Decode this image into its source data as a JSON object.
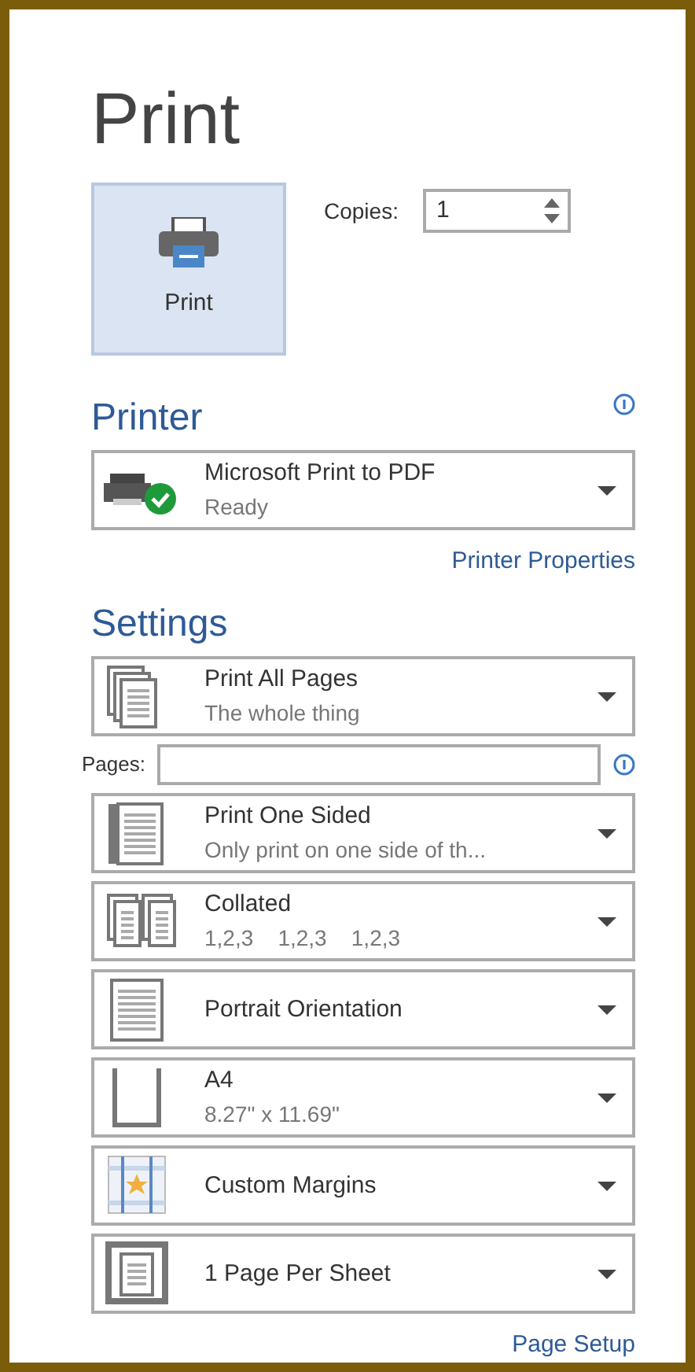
{
  "title": "Print",
  "print_button": {
    "label": "Print"
  },
  "copies": {
    "label": "Copies:",
    "value": "1"
  },
  "printer": {
    "heading": "Printer",
    "name": "Microsoft Print to PDF",
    "status": "Ready",
    "properties_link": "Printer Properties"
  },
  "settings": {
    "heading": "Settings",
    "items": [
      {
        "kind": "dropdown",
        "title": "Print All Pages",
        "subtitle": "The whole thing"
      },
      {
        "kind": "pages-field",
        "label": "Pages:"
      },
      {
        "kind": "dropdown",
        "title": "Print One Sided",
        "subtitle": "Only print on one side of th..."
      },
      {
        "kind": "dropdown",
        "title": "Collated",
        "subtitle": "1,2,3    1,2,3    1,2,3"
      },
      {
        "kind": "dropdown",
        "title": "Portrait Orientation"
      },
      {
        "kind": "dropdown",
        "title": "A4",
        "subtitle": "8.27\" x 11.69\""
      },
      {
        "kind": "dropdown",
        "title": "Custom Margins"
      },
      {
        "kind": "dropdown",
        "title": "1 Page Per Sheet"
      }
    ],
    "page_setup_link": "Page Setup"
  }
}
